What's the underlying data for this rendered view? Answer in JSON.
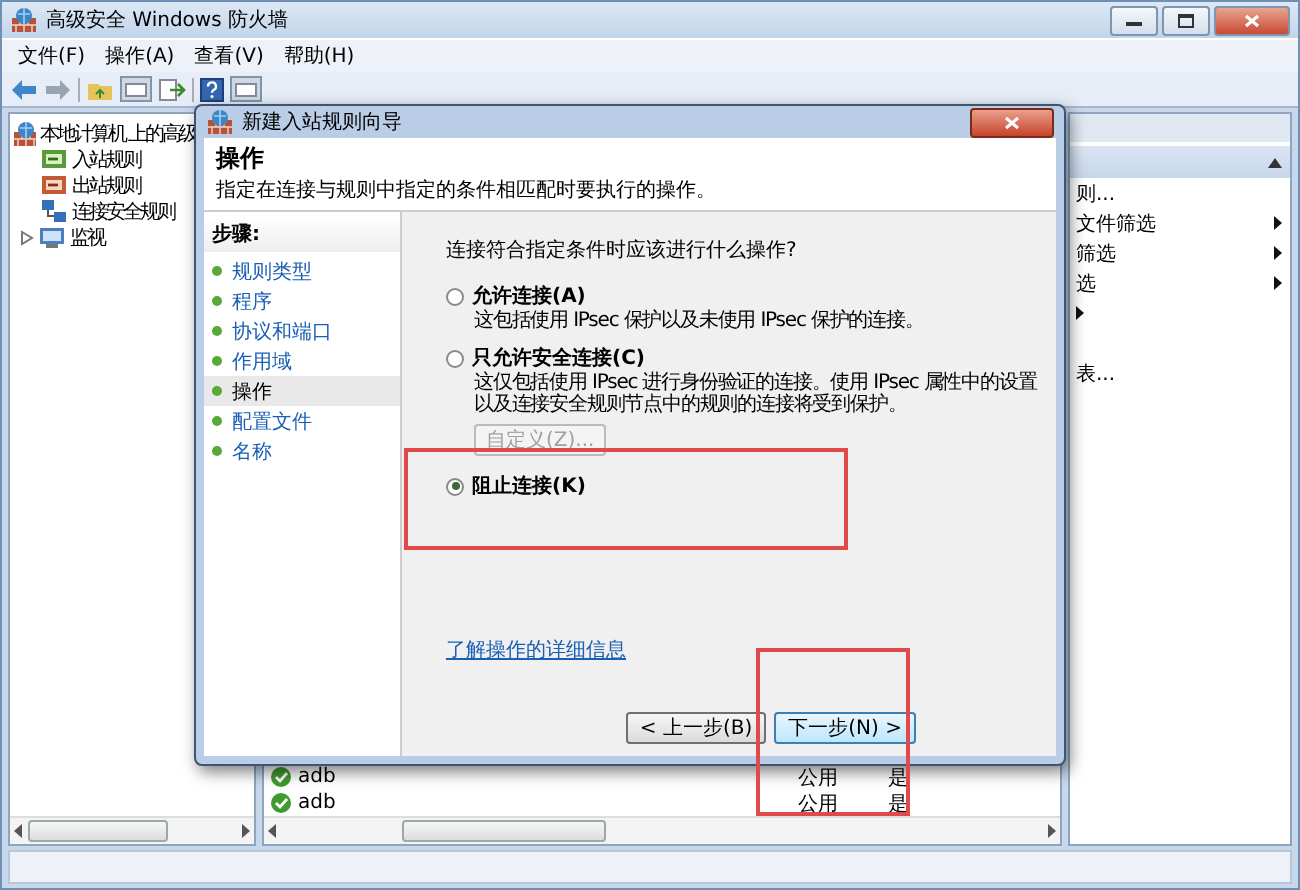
{
  "window": {
    "title": "高级安全 Windows 防火墙"
  },
  "menu": [
    "文件(F)",
    "操作(A)",
    "查看(V)",
    "帮助(H)"
  ],
  "tree": {
    "label": "本地计算机 上的高级",
    "children": [
      {
        "label": "入站规则",
        "kind": "inbound"
      },
      {
        "label": "出站规则",
        "kind": "outbound"
      },
      {
        "label": "连接安全规则",
        "kind": "security"
      },
      {
        "label": "监视",
        "kind": "monitor",
        "collapsed": true
      }
    ]
  },
  "rules": [
    {
      "name": "adb",
      "profile": "公用",
      "enabled": "是"
    },
    {
      "name": "adb",
      "profile": "公用",
      "enabled": "是"
    }
  ],
  "actions": [
    {
      "label": "则...",
      "submenu": false
    },
    {
      "label": "文件筛选",
      "submenu": true
    },
    {
      "label": "筛选",
      "submenu": true
    },
    {
      "label": "选",
      "submenu": true
    },
    {
      "submenu": true
    },
    {
      "label": "表...",
      "submenu": false
    }
  ],
  "dialog": {
    "title": "新建入站规则向导",
    "heading": "操作",
    "subtitle": "指定在连接与规则中指定的条件相匹配时要执行的操作。",
    "steps_title": "步骤:",
    "steps": [
      {
        "label": "规则类型",
        "selected": false
      },
      {
        "label": "程序",
        "selected": false
      },
      {
        "label": "协议和端口",
        "selected": false
      },
      {
        "label": "作用域",
        "selected": false
      },
      {
        "label": "操作",
        "selected": true
      },
      {
        "label": "配置文件",
        "selected": false
      },
      {
        "label": "名称",
        "selected": false
      }
    ],
    "question": "连接符合指定条件时应该进行什么操作?",
    "options": [
      {
        "label": "允许连接(A)",
        "description": "这包括使用 IPsec 保护以及未使用 IPsec 保护的连接。",
        "selected": false,
        "highlighted": false
      },
      {
        "label": "只允许安全连接(C)",
        "description": "这仅包括使用 IPsec 进行身份验证的连接。使用 IPsec 属性中的设置以及连接安全规则节点中的规则的连接将受到保护。",
        "selected": false,
        "highlighted": false,
        "button": {
          "label": "自定义(Z)...",
          "disabled": true
        }
      },
      {
        "label": "阻止连接(K)",
        "selected": true,
        "highlighted": true
      }
    ],
    "link": "了解操作的详细信息",
    "buttons": [
      {
        "label": "< 上一步(B)",
        "highlighted": false
      },
      {
        "label": "下一步(N) >",
        "highlighted": true
      }
    ]
  }
}
